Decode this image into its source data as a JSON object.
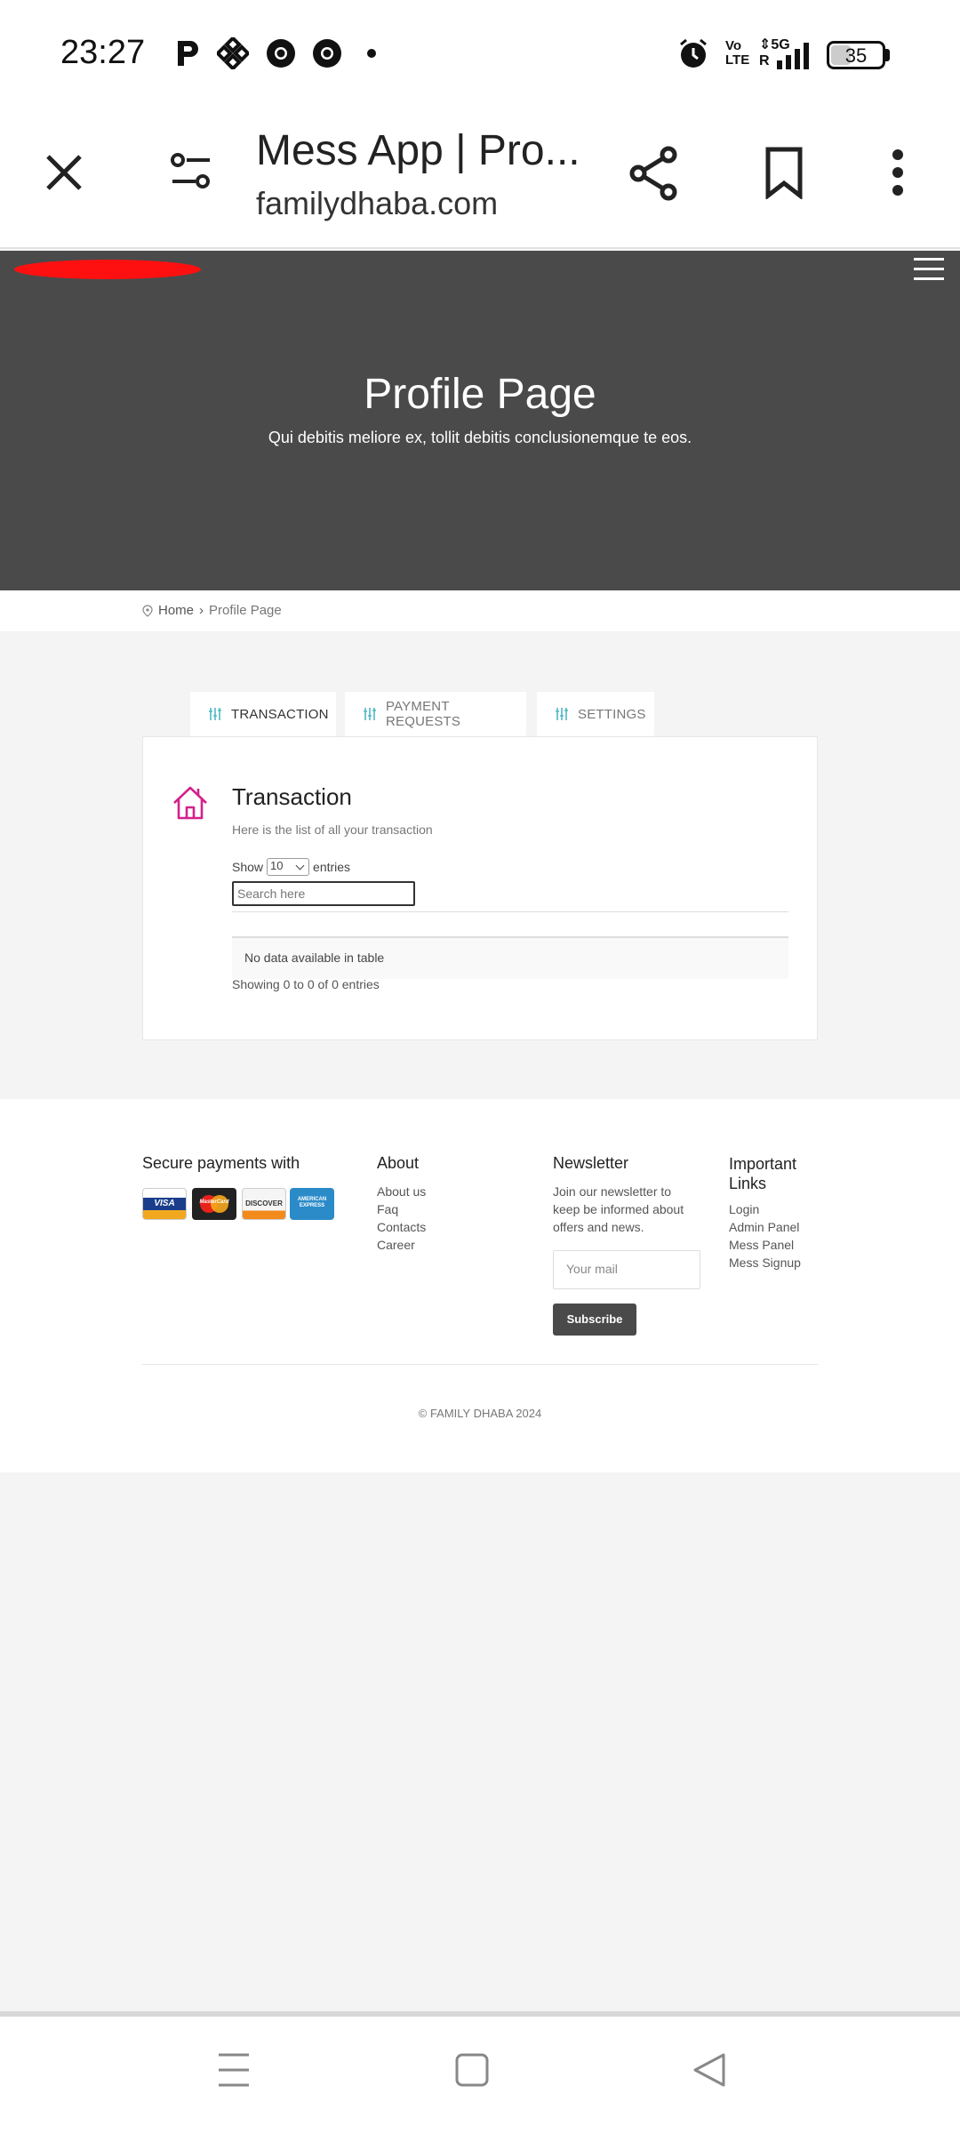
{
  "status_bar": {
    "time": "23:27",
    "battery": "35",
    "network": "5G",
    "volte_line1": "Vo",
    "volte_line2": "LTE",
    "sim_label": "R"
  },
  "browser": {
    "title": "Mess App | Pro...",
    "domain": "familydhaba.com"
  },
  "hero": {
    "title": "Profile Page",
    "subtitle": "Qui debitis meliore ex, tollit debitis conclusionemque te eos."
  },
  "breadcrumb": {
    "home": "Home",
    "separator": "›",
    "current": "Profile Page"
  },
  "tabs": [
    {
      "label": "TRANSACTION",
      "active": true
    },
    {
      "label": "PAYMENT REQUESTS",
      "active": false
    },
    {
      "label": "SETTINGS",
      "active": false
    }
  ],
  "panel": {
    "title": "Transaction",
    "subtitle": "Here is the list of all your transaction",
    "show_label": "Show",
    "entries_value": "10",
    "entries_label": "entries",
    "search_placeholder": "Search here",
    "empty_text": "No data available in table",
    "info_text": "Showing 0 to 0 of 0 entries",
    "icon_color": "#d4218b"
  },
  "footer": {
    "payments_heading": "Secure payments with",
    "cards": [
      "VISA",
      "MasterCard",
      "DISCOVER",
      "AMERICAN EXPRESS"
    ],
    "about_heading": "About",
    "about_links": [
      "About us",
      "Faq",
      "Contacts",
      "Career"
    ],
    "newsletter_heading": "Newsletter",
    "newsletter_text": "Join our newsletter to keep be informed about offers and news.",
    "mail_placeholder": "Your mail",
    "subscribe_label": "Subscribe",
    "important_heading_1": "Important",
    "important_heading_2": "Links",
    "important_links": [
      "Login",
      "Admin Panel",
      "Mess Panel",
      "Mess Signup"
    ],
    "copyright": "© FAMILY DHABA 2024"
  },
  "colors": {
    "hero_bg": "#4a4a4a",
    "logo_red": "#ff1010",
    "tab_icon": "#4fb8c4",
    "accent_pink": "#d4218b"
  }
}
